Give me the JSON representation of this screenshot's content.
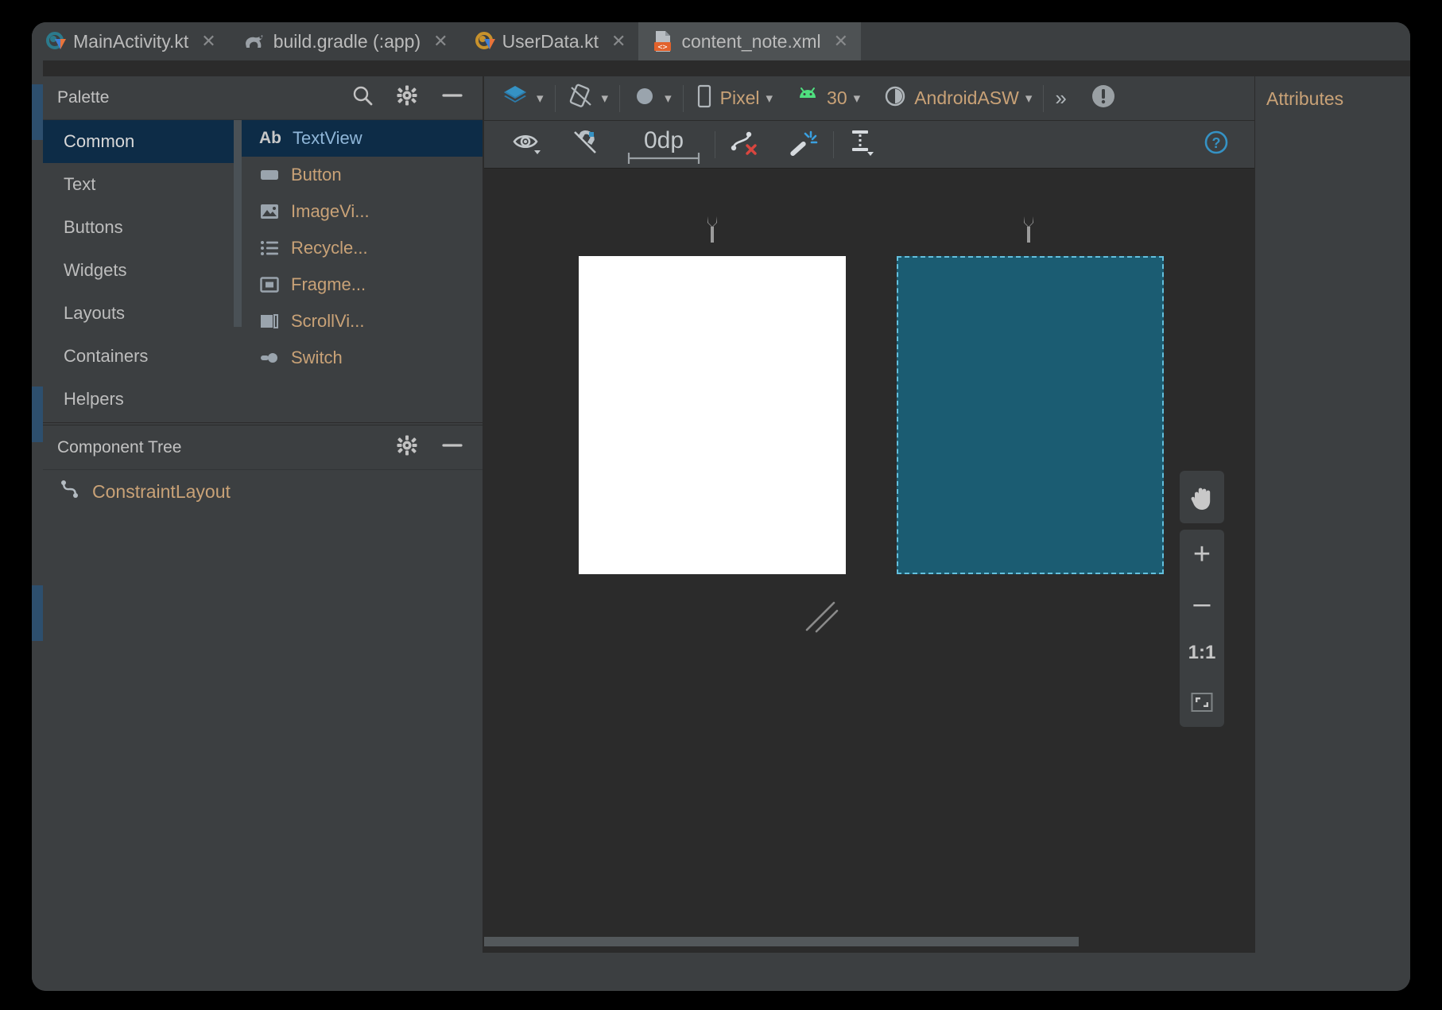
{
  "window": {
    "background": "#3c3f41",
    "accent_blue": "#3592c4",
    "selection_navy": "#0d2c47"
  },
  "tabs": [
    {
      "label": "MainActivity.kt",
      "icon": "kotlin-file-icon",
      "close": "✕",
      "active": false
    },
    {
      "label": "build.gradle (:app)",
      "icon": "gradle-file-icon",
      "close": "✕",
      "active": false
    },
    {
      "label": "UserData.kt",
      "icon": "kotlin-data-class-icon",
      "close": "✕",
      "active": false
    },
    {
      "label": "content_note.xml",
      "icon": "android-xml-layout-icon",
      "close": "✕",
      "active": true
    }
  ],
  "palette": {
    "title": "Palette",
    "header_icons": [
      "search-icon",
      "gear-icon",
      "minimize-icon"
    ],
    "categories": [
      {
        "label": "Common",
        "selected": true
      },
      {
        "label": "Text",
        "selected": false
      },
      {
        "label": "Buttons",
        "selected": false
      },
      {
        "label": "Widgets",
        "selected": false
      },
      {
        "label": "Layouts",
        "selected": false
      },
      {
        "label": "Containers",
        "selected": false
      },
      {
        "label": "Helpers",
        "selected": false
      }
    ],
    "items": [
      {
        "label": "TextView",
        "icon": "textview-ab-icon",
        "selected": true
      },
      {
        "label": "Button",
        "icon": "button-icon",
        "selected": false
      },
      {
        "label": "ImageVi...",
        "icon": "imageview-icon",
        "selected": false
      },
      {
        "label": "Recycle...",
        "icon": "recyclerview-list-icon",
        "selected": false
      },
      {
        "label": "Fragme...",
        "icon": "fragment-icon",
        "selected": false
      },
      {
        "label": "ScrollVi...",
        "icon": "scrollview-icon",
        "selected": false
      },
      {
        "label": "Switch",
        "icon": "switch-icon",
        "selected": false
      }
    ],
    "ab_glyph": "Ab"
  },
  "component_tree": {
    "title": "Component Tree",
    "header_icons": [
      "gear-icon",
      "minimize-icon"
    ],
    "nodes": [
      {
        "label": "ConstraintLayout",
        "icon": "constraintlayout-icon"
      }
    ]
  },
  "design_toolbar": {
    "design_mode_icon": "layers-design-surface-icon",
    "orientation_icon": "rotate-orientation-icon",
    "theme_icon": "ui-mode-night-icon",
    "device": {
      "label": "Pixel",
      "icon": "phone-device-icon",
      "caret": "⌄"
    },
    "api_level": {
      "label": "30",
      "icon": "android-robot-icon",
      "caret": "⌄"
    },
    "theme": {
      "label": "AndroidASW",
      "icon": "theme-contrast-icon",
      "caret": "⌄"
    },
    "overflow": "»",
    "issues_icon": "warning-issues-icon"
  },
  "constraint_toolbar": {
    "show_constraints_icon": "eye-show-constraints-icon",
    "autoconnect_icon": "autoconnect-magnet-off-icon",
    "default_margin": "0dp",
    "clear_constraints_icon": "clear-all-constraints-icon",
    "infer_constraints_icon": "magic-wand-infer-constraints-icon",
    "guidelines_icon": "add-guideline-icon",
    "help_icon": "help-question-icon"
  },
  "canvas": {
    "device_preview_label": "device-render-surface",
    "blueprint_label": "blueprint-render-surface",
    "blueprint_color": "#1b5c72",
    "blueprint_border_color": "#63c0de",
    "device_color": "#ffffff"
  },
  "zoom_controls": {
    "pan": "pan-hand-icon",
    "zoom_in": "+",
    "zoom_out": "–",
    "actual_size": "1:1",
    "zoom_to_fit": "zoom-to-fit-icon"
  },
  "attributes": {
    "title": "Attributes"
  }
}
